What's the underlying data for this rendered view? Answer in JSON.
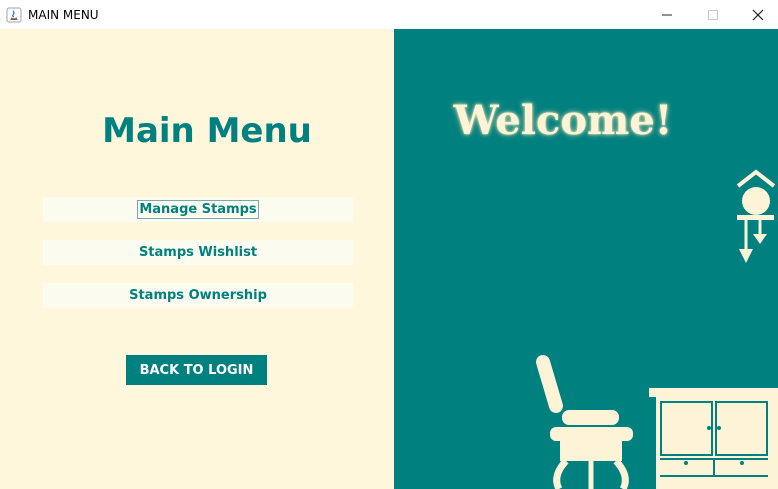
{
  "window": {
    "title": "MAIN MENU",
    "controls": [
      "minimize",
      "maximize",
      "close"
    ]
  },
  "left_panel": {
    "heading": "Main Menu",
    "menu_items": [
      {
        "label": "Manage Stamps",
        "focused": true
      },
      {
        "label": "Stamps Wishlist",
        "focused": false
      },
      {
        "label": "Stamps Ownership",
        "focused": false
      }
    ],
    "back_button": "BACK TO LOGIN"
  },
  "right_panel": {
    "welcome": "Welcome!",
    "illustration": [
      "wall-lamp-icon",
      "chair-icon",
      "cabinet-icon"
    ]
  },
  "colors": {
    "teal": "#00807f",
    "cream": "#fef7dc",
    "button_bg": "#fcfbef",
    "illustration": "#fdf3d6"
  }
}
